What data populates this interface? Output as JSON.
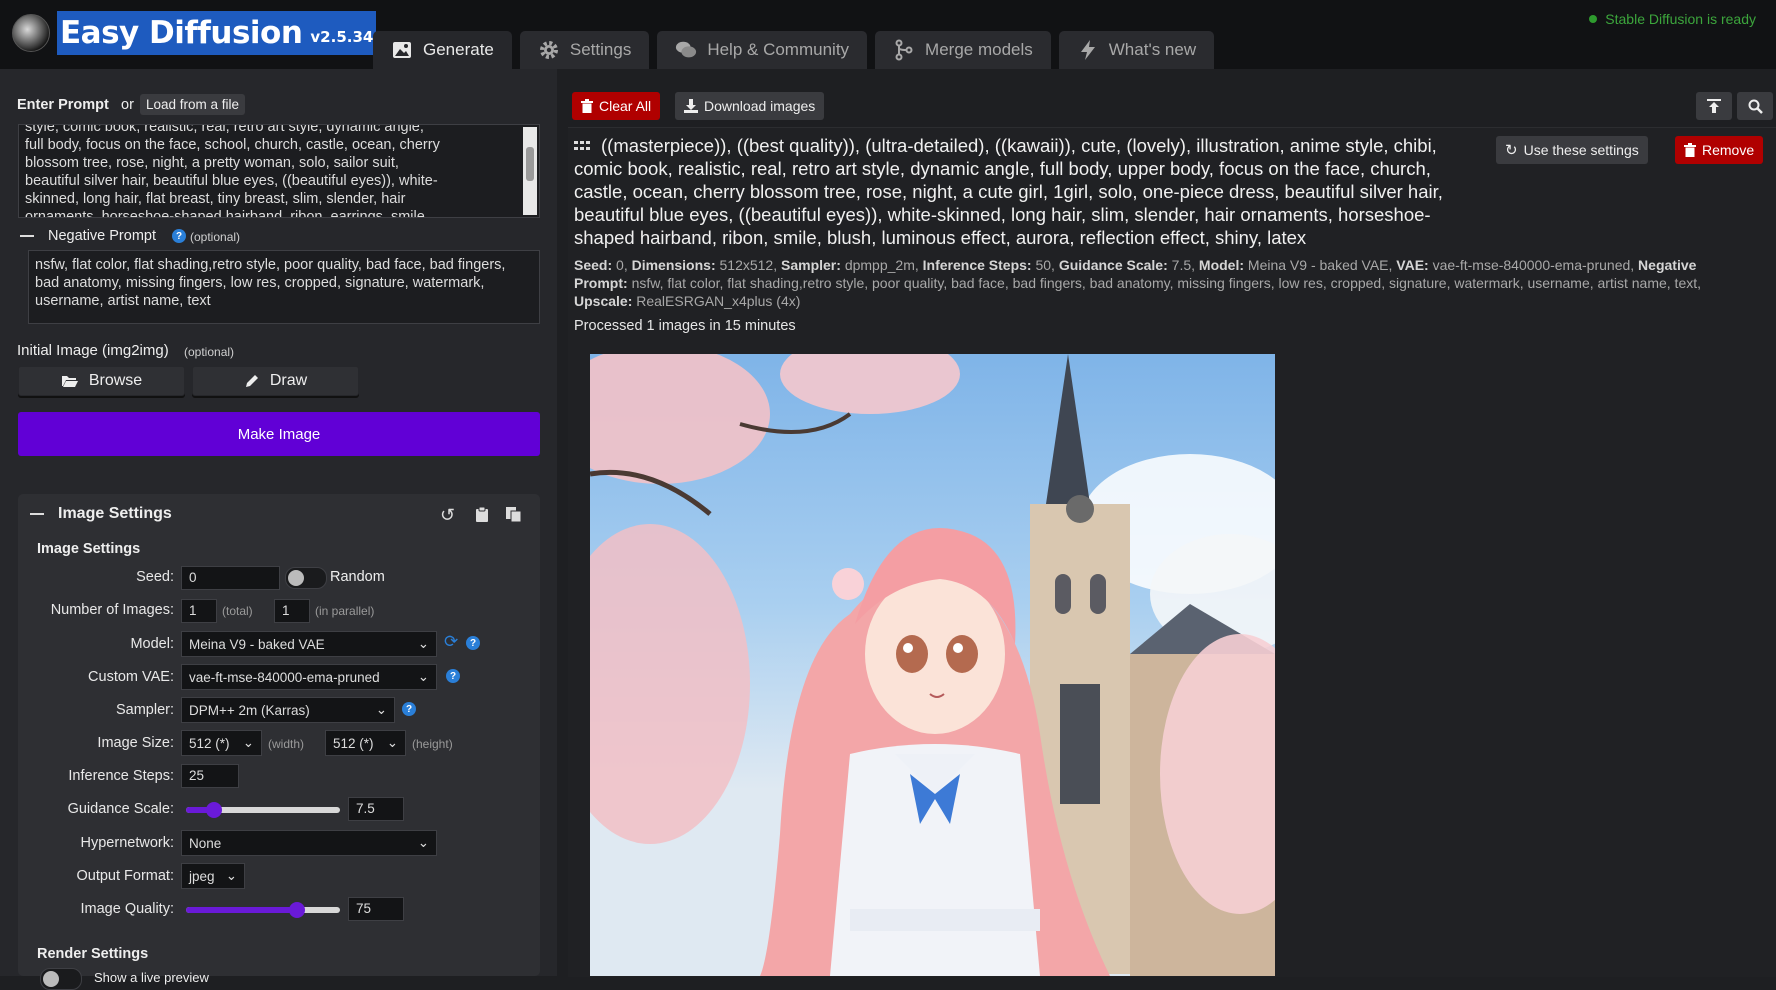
{
  "app": {
    "title": "Easy Diffusion",
    "version": "v2.5.34",
    "status": "Stable Diffusion is ready"
  },
  "tabs": [
    {
      "label": "Generate",
      "icon": "image-icon"
    },
    {
      "label": "Settings",
      "icon": "gear-icon"
    },
    {
      "label": "Help & Community",
      "icon": "comments-icon"
    },
    {
      "label": "Merge models",
      "icon": "merge-icon"
    },
    {
      "label": "What's new",
      "icon": "bolt-icon"
    }
  ],
  "prompt": {
    "label": "Enter Prompt",
    "or": "or",
    "load_file": "Load from a file",
    "lines": [
      "style, comic book, realistic, real, retro art style, dynamic angle,",
      "full body, focus on the face, school, church, castle, ocean, cherry",
      "blossom tree, rose, night, a pretty woman, solo, sailor suit,",
      "beautiful silver hair, beautiful blue eyes, ((beautiful eyes)), white-",
      "skinned, long hair, flat breast, tiny breast, slim, slender, hair",
      "ornaments, horseshoe-shaped hairband, ribon, earrings, smile,"
    ]
  },
  "negative": {
    "label": "Negative Prompt",
    "optional": "(optional)",
    "value": "nsfw, flat color, flat shading,retro style, poor quality, bad face, bad fingers, bad anatomy, missing fingers, low res, cropped, signature, watermark, username, artist name, text"
  },
  "initial_image": {
    "label": "Initial Image (img2img)",
    "optional": "(optional)",
    "browse": "Browse",
    "draw": "Draw"
  },
  "make_image": "Make Image",
  "image_settings": {
    "header": "Image Settings",
    "subheader": "Image Settings",
    "seed_label": "Seed:",
    "seed_value": "0",
    "random_label": "Random",
    "num_images_label": "Number of Images:",
    "num_total": "1",
    "total_hint": "(total)",
    "num_parallel": "1",
    "parallel_hint": "(in parallel)",
    "model_label": "Model:",
    "model_value": "Meina V9 - baked VAE",
    "vae_label": "Custom VAE:",
    "vae_value": "vae-ft-mse-840000-ema-pruned",
    "sampler_label": "Sampler:",
    "sampler_value": "DPM++ 2m (Karras)",
    "size_label": "Image Size:",
    "width_value": "512 (*)",
    "width_hint": "(width)",
    "height_value": "512 (*)",
    "height_hint": "(height)",
    "steps_label": "Inference Steps:",
    "steps_value": "25",
    "guidance_label": "Guidance Scale:",
    "guidance_value": "7.5",
    "guidance_fraction": 0.18,
    "hypernetwork_label": "Hypernetwork:",
    "hypernetwork_value": "None",
    "format_label": "Output Format:",
    "format_value": "jpeg",
    "quality_label": "Image Quality:",
    "quality_value": "75",
    "quality_fraction": 0.72,
    "render_header": "Render Settings",
    "render_partial": "Show a live preview"
  },
  "toolbar": {
    "clear_all": "Clear All",
    "download": "Download images"
  },
  "result": {
    "prompt": "((masterpiece)), ((best quality)), (ultra-detailed), ((kawaii)), cute, (lovely), illustration, anime style, chibi, comic book, realistic, real, retro art style, dynamic angle, full body, upper body, focus on the face, church, castle, ocean, cherry blossom tree, rose, night, a cute girl, 1girl, solo, one-piece dress, beautiful silver hair, beautiful blue eyes, ((beautiful eyes)), white-skinned, long hair, slim, slender, hair ornaments, horseshoe-shaped hairband, ribon, smile, blush, luminous effect, aurora, reflection effect, shiny, latex",
    "use_settings": "Use these settings",
    "remove": "Remove",
    "meta": {
      "seed_k": "Seed:",
      "seed_v": "0",
      "dim_k": "Dimensions:",
      "dim_v": "512x512",
      "sampler_k": "Sampler:",
      "sampler_v": "dpmpp_2m",
      "steps_k": "Inference Steps:",
      "steps_v": "50",
      "guidance_k": "Guidance Scale:",
      "guidance_v": "7.5",
      "model_k": "Model:",
      "model_v": "Meina V9 - baked VAE",
      "vae_k": "VAE:",
      "vae_v": "vae-ft-mse-840000-ema-pruned",
      "neg_k": "Negative Prompt:",
      "neg_v": "nsfw, flat color, flat shading,retro style, poor quality, bad face, bad fingers, bad anatomy, missing fingers, low res, cropped, signature, watermark, username, artist name, text",
      "upscale_k": "Upscale:",
      "upscale_v": "RealESRGAN_x4plus (4x)"
    },
    "processed": "Processed 1 images in 15 minutes"
  },
  "colors": {
    "accent": "#6100d6",
    "danger": "#b00000",
    "ready": "#3ca53c",
    "title_highlight": "#1e5bbf"
  }
}
